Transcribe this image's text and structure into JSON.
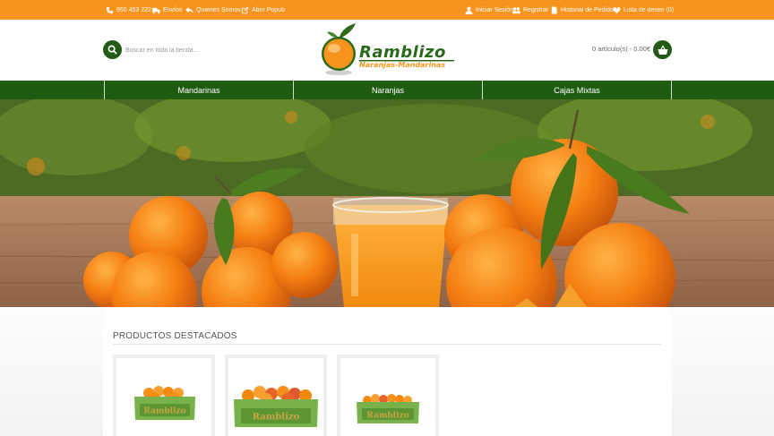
{
  "topbar": {
    "phone": "950 453 222",
    "envios": "Envíos",
    "quienes": "Quienes Somos",
    "popup": "Abrir Popub",
    "login": "Iniciar Sesión",
    "register": "Registrar",
    "orders": "Historial de Pedidos",
    "wishlist": "Lista de deseo (0)"
  },
  "header": {
    "search_placeholder": "Buscar en toda la tienda...",
    "logo_word": "Ramblizo",
    "logo_sub": "Naranjas-Mandarinas",
    "cart_text": "0 artículo(s) - 0.00€"
  },
  "nav": {
    "items": [
      {
        "label": "Mandarinas"
      },
      {
        "label": "Naranjas"
      },
      {
        "label": "Cajas Mixtas"
      }
    ]
  },
  "featured": {
    "title": "PRODUCTOS DESTACADOS",
    "box_brand": "Ramblizo"
  },
  "colors": {
    "orange": "#f7941d",
    "green": "#1f5c12",
    "dark_green": "#235b16"
  },
  "icons": [
    "phone-icon",
    "truck-icon",
    "reply-icon",
    "external-link-icon",
    "user-icon",
    "users-icon",
    "file-icon",
    "heart-icon",
    "search-icon",
    "basket-icon"
  ]
}
